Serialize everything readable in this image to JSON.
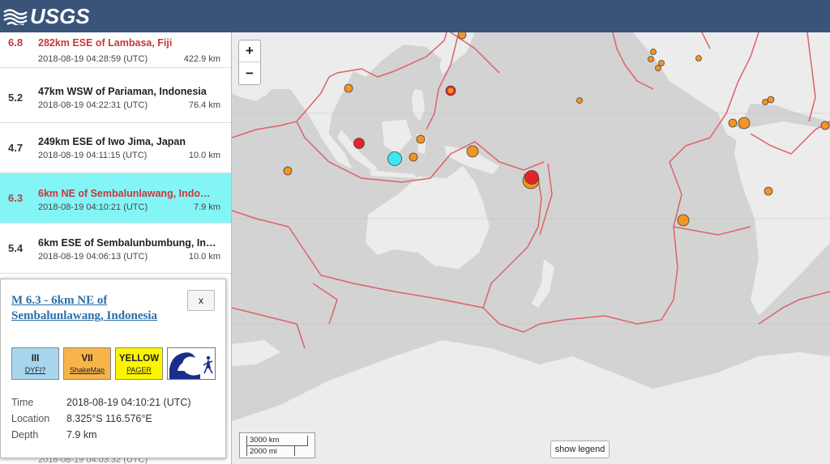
{
  "header": {
    "logo_text": "USGS"
  },
  "events": [
    {
      "mag": "6.8",
      "place": "282km ESE of Lambasa, Fiji",
      "time": "2018-08-19 04:28:59 (UTC)",
      "depth": "422.9 km"
    },
    {
      "mag": "5.2",
      "place": "47km WSW of Pariaman, Indonesia",
      "time": "2018-08-19 04:22:31 (UTC)",
      "depth": "76.4 km"
    },
    {
      "mag": "4.7",
      "place": "249km ESE of Iwo Jima, Japan",
      "time": "2018-08-19 04:11:15 (UTC)",
      "depth": "10.0 km"
    },
    {
      "mag": "6.3",
      "place": "6km NE of Sembalunlawang, Indo…",
      "time": "2018-08-19 04:10:21 (UTC)",
      "depth": "7.9 km"
    },
    {
      "mag": "5.4",
      "place": "6km ESE of Sembalunbumbung, In…",
      "time": "2018-08-19 04:06:13 (UTC)",
      "depth": "10.0 km"
    }
  ],
  "popup": {
    "title": "M 6.3 - 6km NE of Sembalunlawang, Indonesia",
    "close_label": "x",
    "dyfi": {
      "value": "III",
      "label": "DYFI?",
      "color": "#a8d5ee"
    },
    "shakemap": {
      "value": "VII",
      "label": "ShakeMap",
      "color": "#f6b44a"
    },
    "pager": {
      "value": "YELLOW",
      "label": "PAGER",
      "color": "#fdf500"
    },
    "tsunami_icon": "tsunami-wave-icon",
    "time_label": "Time",
    "time_value": "2018-08-19 04:10:21 (UTC)",
    "location_label": "Location",
    "location_value": "8.325°S 116.576°E",
    "depth_label": "Depth",
    "depth_value": "7.9 km"
  },
  "map": {
    "zoom_in": "+",
    "zoom_out": "−",
    "scale_km": "3000 km",
    "scale_mi": "2000 mi",
    "show_legend": "show legend"
  },
  "colors": {
    "header_bg": "#3a5479",
    "selected_row": "#84f5f7",
    "red_event": "#c7373b",
    "orange_marker": "#f39423",
    "cyan_marker": "#3de6f0"
  }
}
